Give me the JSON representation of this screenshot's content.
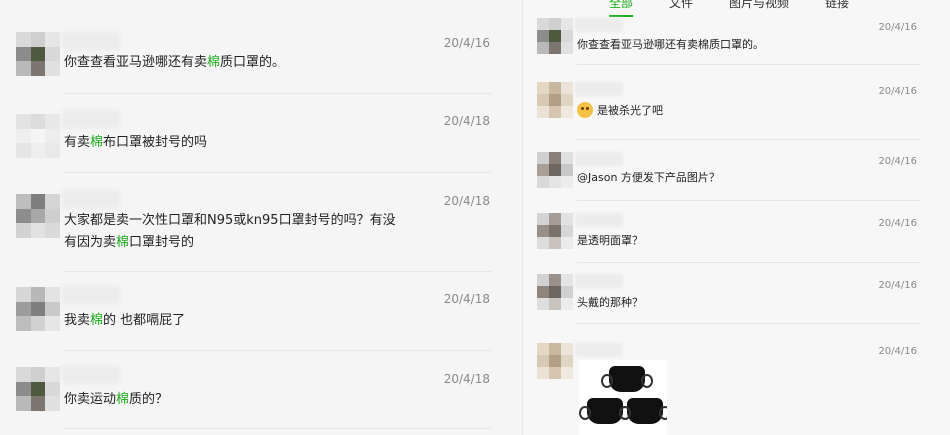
{
  "tabs": [
    {
      "label": "全部",
      "active": true
    },
    {
      "label": "文件",
      "active": false
    },
    {
      "label": "图片与视频",
      "active": false
    },
    {
      "label": "链接",
      "active": false
    }
  ],
  "left_messages": [
    {
      "date": "20/4/16",
      "pre": "你查查看亚马逊哪还有卖",
      "hl": "棉",
      "post": "质口罩的。"
    },
    {
      "date": "20/4/18",
      "pre": "有卖",
      "hl": "棉",
      "post": "布口罩被封号的吗"
    },
    {
      "date": "20/4/18",
      "line1": "大家都是卖一次性口罩和N95或kn95口罩封号的吗？有没",
      "pre": "有因为卖",
      "hl": "棉",
      "post": "口罩封号的"
    },
    {
      "date": "20/4/18",
      "pre": "我卖",
      "hl": "棉",
      "post": "的 也都嗝屁了"
    },
    {
      "date": "20/4/18",
      "pre": "你卖运动",
      "hl": "棉",
      "post": "质的？"
    }
  ],
  "right_messages": [
    {
      "date": "20/4/16",
      "text": "你查查看亚马逊哪还有卖棉质口罩的。"
    },
    {
      "date": "20/4/16",
      "text": "是被杀光了吧",
      "emoji": "dizzy-face-emoji"
    },
    {
      "date": "20/4/16",
      "text": "@Jason 方便发下产品图片？"
    },
    {
      "date": "20/4/16",
      "text": "是透明面罩？"
    },
    {
      "date": "20/4/16",
      "text": "头戴的那种？"
    },
    {
      "date": "20/4/16",
      "image": "black-face-masks-photo"
    }
  ],
  "colors": {
    "accent": "#1aad19",
    "date": "#8a8a8a",
    "background": "#f5f5f5"
  }
}
